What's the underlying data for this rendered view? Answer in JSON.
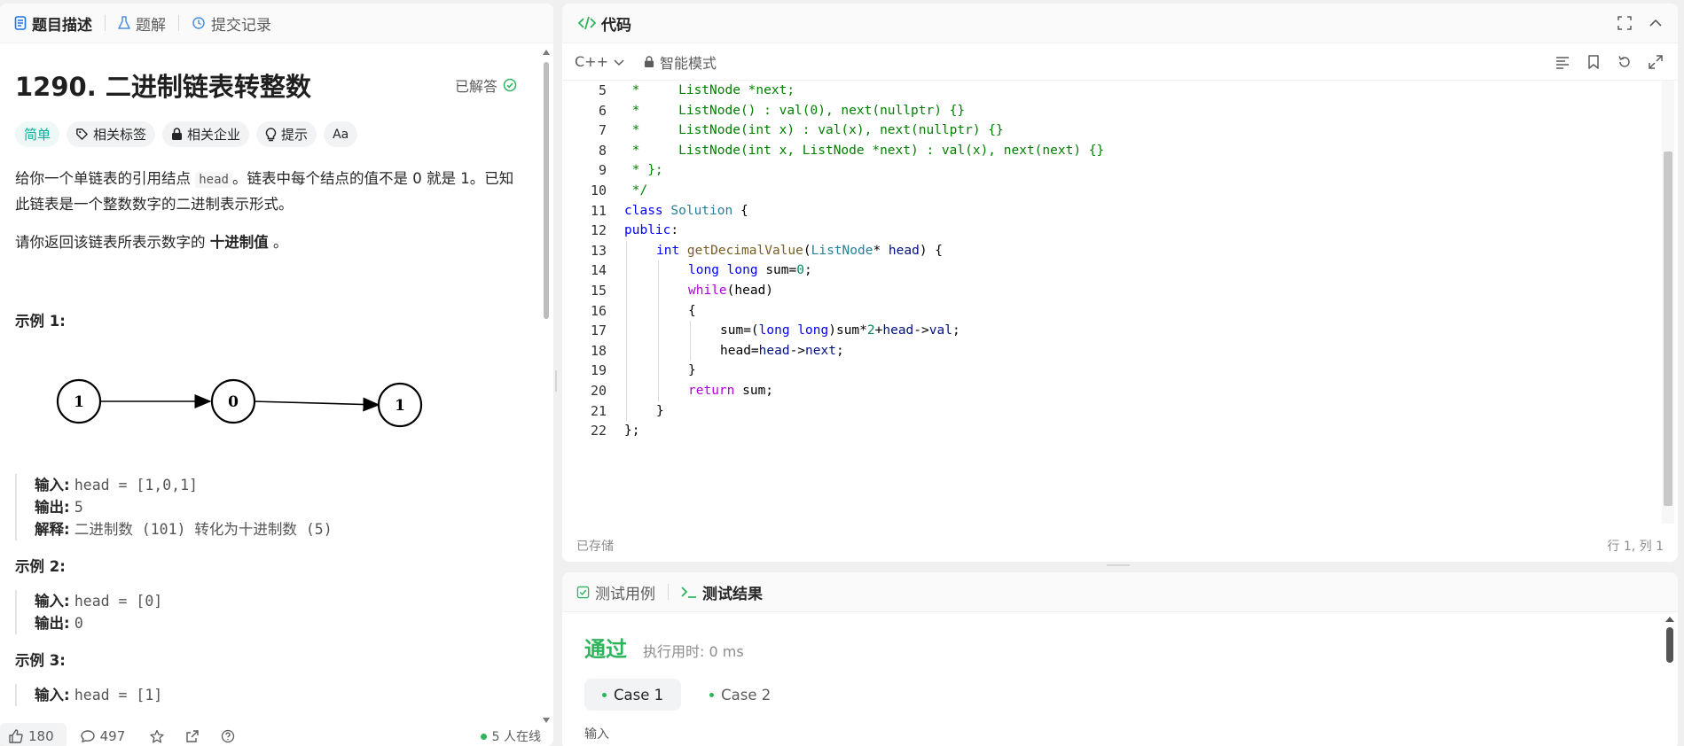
{
  "left_tabs": [
    {
      "label": "题目描述",
      "icon": "document-icon"
    },
    {
      "label": "题解",
      "icon": "flask-icon"
    },
    {
      "label": "提交记录",
      "icon": "history-icon"
    }
  ],
  "problem": {
    "title": "1290. 二进制链表转整数",
    "status": "已解答",
    "tags": [
      {
        "label": "简单",
        "icon": ""
      },
      {
        "label": "相关标签",
        "icon": "tag-icon"
      },
      {
        "label": "相关企业",
        "icon": "lock-icon"
      },
      {
        "label": "提示",
        "icon": "lightbulb-icon"
      },
      {
        "label": "Aa",
        "icon": "translate-icon"
      }
    ],
    "desc_p1_a": "给你一个单链表的引用结点 ",
    "desc_p1_code": "head",
    "desc_p1_b": "。链表中每个结点的值不是 0 就是 1。已知此链表是一个整数数字的二进制表示形式。",
    "desc_p2_a": "请你返回该链表所表示数字的 ",
    "desc_p2_bold": "十进制值",
    "desc_p2_b": " 。",
    "examples": [
      {
        "title": "示例 1:",
        "input_label": "输入:",
        "input": "head = [1,0,1]",
        "output_label": "输出:",
        "output": "5",
        "explain_label": "解释:",
        "explain": "二进制数 (101) 转化为十进制数 (5)"
      },
      {
        "title": "示例 2:",
        "input_label": "输入:",
        "input": "head = [0]",
        "output_label": "输出:",
        "output": "0"
      },
      {
        "title": "示例 3:",
        "input_label": "输入:",
        "input": "head = [1]"
      }
    ],
    "diagram_nodes": [
      "1",
      "0",
      "1"
    ]
  },
  "left_footer": {
    "likes": "180",
    "comments": "497",
    "online": "5 人在线"
  },
  "code_panel": {
    "title": "代码",
    "language": "C++",
    "mode": "智能模式",
    "saved": "已存储",
    "cursor": "行 1, 列 1"
  },
  "code_lines": [
    {
      "n": "5",
      "indent": 0,
      "tokens": [
        [
          "c-comment",
          " *     ListNode *next;"
        ]
      ]
    },
    {
      "n": "6",
      "indent": 0,
      "tokens": [
        [
          "c-comment",
          " *     ListNode() : val(0), next(nullptr) {}"
        ]
      ]
    },
    {
      "n": "7",
      "indent": 0,
      "tokens": [
        [
          "c-comment",
          " *     ListNode(int x) : val(x), next(nullptr) {}"
        ]
      ]
    },
    {
      "n": "8",
      "indent": 0,
      "tokens": [
        [
          "c-comment",
          " *     ListNode(int x, ListNode *next) : val(x), next(next) {}"
        ]
      ]
    },
    {
      "n": "9",
      "indent": 0,
      "tokens": [
        [
          "c-comment",
          " * };"
        ]
      ]
    },
    {
      "n": "10",
      "indent": 0,
      "tokens": [
        [
          "c-comment",
          " */"
        ]
      ]
    },
    {
      "n": "11",
      "indent": 0,
      "tokens": [
        [
          "c-kw",
          "class "
        ],
        [
          "c-type",
          "Solution"
        ],
        [
          "c-plain",
          " {"
        ]
      ]
    },
    {
      "n": "12",
      "indent": 0,
      "tokens": [
        [
          "c-kw",
          "public"
        ],
        [
          "c-plain",
          ":"
        ]
      ]
    },
    {
      "n": "13",
      "indent": 1,
      "tokens": [
        [
          "c-kw",
          "int "
        ],
        [
          "c-fn",
          "getDecimalValue"
        ],
        [
          "c-plain",
          "("
        ],
        [
          "c-type",
          "ListNode"
        ],
        [
          "c-plain",
          "* "
        ],
        [
          "c-var",
          "head"
        ],
        [
          "c-plain",
          ") {"
        ]
      ]
    },
    {
      "n": "14",
      "indent": 2,
      "tokens": [
        [
          "c-kw",
          "long long "
        ],
        [
          "c-plain",
          "sum="
        ],
        [
          "c-num",
          "0"
        ],
        [
          "c-plain",
          ";"
        ]
      ]
    },
    {
      "n": "15",
      "indent": 2,
      "tokens": [
        [
          "c-ctl",
          "while"
        ],
        [
          "c-plain",
          "(head)"
        ]
      ]
    },
    {
      "n": "16",
      "indent": 2,
      "tokens": [
        [
          "c-plain",
          "{"
        ]
      ]
    },
    {
      "n": "17",
      "indent": 3,
      "tokens": [
        [
          "c-plain",
          "sum=("
        ],
        [
          "c-kw",
          "long long"
        ],
        [
          "c-plain",
          ")sum*"
        ],
        [
          "c-num",
          "2"
        ],
        [
          "c-plain",
          "+"
        ],
        [
          "c-var",
          "head"
        ],
        [
          "c-plain",
          "->"
        ],
        [
          "c-var",
          "val"
        ],
        [
          "c-plain",
          ";"
        ]
      ]
    },
    {
      "n": "18",
      "indent": 3,
      "tokens": [
        [
          "c-plain",
          "head="
        ],
        [
          "c-var",
          "head"
        ],
        [
          "c-plain",
          "->"
        ],
        [
          "c-var",
          "next"
        ],
        [
          "c-plain",
          ";"
        ]
      ]
    },
    {
      "n": "19",
      "indent": 2,
      "tokens": [
        [
          "c-plain",
          "}"
        ]
      ]
    },
    {
      "n": "20",
      "indent": 2,
      "tokens": [
        [
          "c-ctl",
          "return "
        ],
        [
          "c-plain",
          "sum;"
        ]
      ]
    },
    {
      "n": "21",
      "indent": 1,
      "tokens": [
        [
          "c-plain",
          "}"
        ]
      ]
    },
    {
      "n": "22",
      "indent": 0,
      "tokens": [
        [
          "c-plain",
          "};"
        ]
      ]
    }
  ],
  "test_panel": {
    "tabs": [
      {
        "label": "测试用例",
        "icon": "checkbox-icon"
      },
      {
        "label": "测试结果",
        "icon": "terminal-icon"
      }
    ],
    "status": "通过",
    "runtime": "执行用时: 0 ms",
    "cases": [
      "Case 1",
      "Case 2"
    ],
    "input_label": "输入"
  },
  "colors": {
    "accent_green": "#2db55d",
    "easy": "#00af9b",
    "comment": "#008000",
    "keyword": "#0000ff"
  }
}
